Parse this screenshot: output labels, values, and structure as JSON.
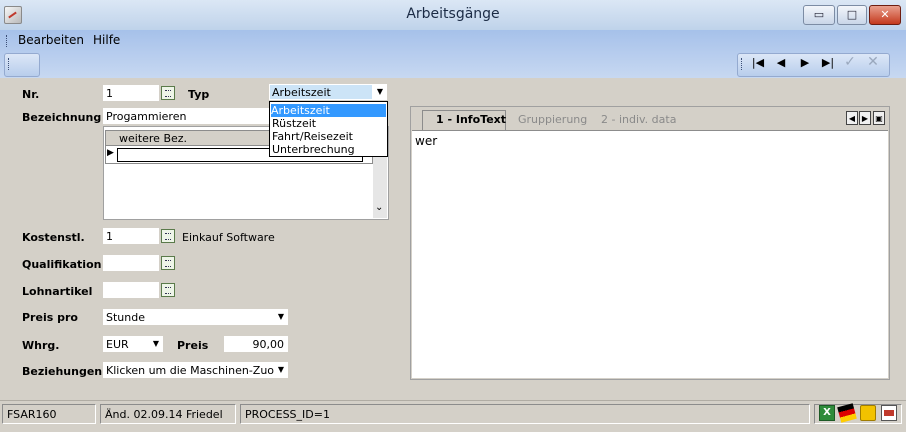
{
  "window": {
    "title": "Arbeitsgänge",
    "minimize": "▭",
    "maximize": "□",
    "close": "✕"
  },
  "menu": {
    "items": [
      "Bearbeiten",
      "Hilfe"
    ]
  },
  "toolbar": {
    "nav_first": "|◀",
    "nav_prev": "◀",
    "nav_next": "▶",
    "nav_last": "▶|",
    "confirm": "✓",
    "cancel": "✕"
  },
  "form": {
    "nr_label": "Nr.",
    "nr_value": "1",
    "typ_label": "Typ",
    "typ_value": "Arbeitszeit",
    "typ_options": [
      "Arbeitszeit",
      "Rüstzeit",
      "Fahrt/Reisezeit",
      "Unterbrechung"
    ],
    "bezeichnung_label": "Bezeichnung",
    "bezeichnung_value": "Progammieren",
    "weitere_bez_header": "weitere Bez.",
    "kostenstl_label": "Kostenstl.",
    "kostenstl_value": "1",
    "kostenstl_desc": "Einkauf Software",
    "qualifikation_label": "Qualifikation",
    "qualifikation_value": "",
    "lohnartikel_label": "Lohnartikel",
    "lohnartikel_value": "",
    "preis_pro_label": "Preis pro",
    "preis_pro_value": "Stunde",
    "whrg_label": "Whrg.",
    "whrg_value": "EUR",
    "preis_label": "Preis",
    "preis_value": "90,00",
    "beziehungen_label": "Beziehungen",
    "beziehungen_value": "Klicken um die Maschinen-Zuordnun"
  },
  "tabs": [
    {
      "label": "1 - InfoText",
      "active": true
    },
    {
      "label": "Gruppierung",
      "active": false
    },
    {
      "label": "2 - indiv. data",
      "active": false
    }
  ],
  "infotext": "wer",
  "status": {
    "module": "FSAR160",
    "changed": "Änd. 02.09.14 Friedel",
    "process": "PROCESS_ID=1"
  },
  "colors": {
    "titlebar": "#c9dbf0",
    "menuband": "#b3caee",
    "selection": "#3399ff",
    "window_bg": "#d4d0c8"
  }
}
